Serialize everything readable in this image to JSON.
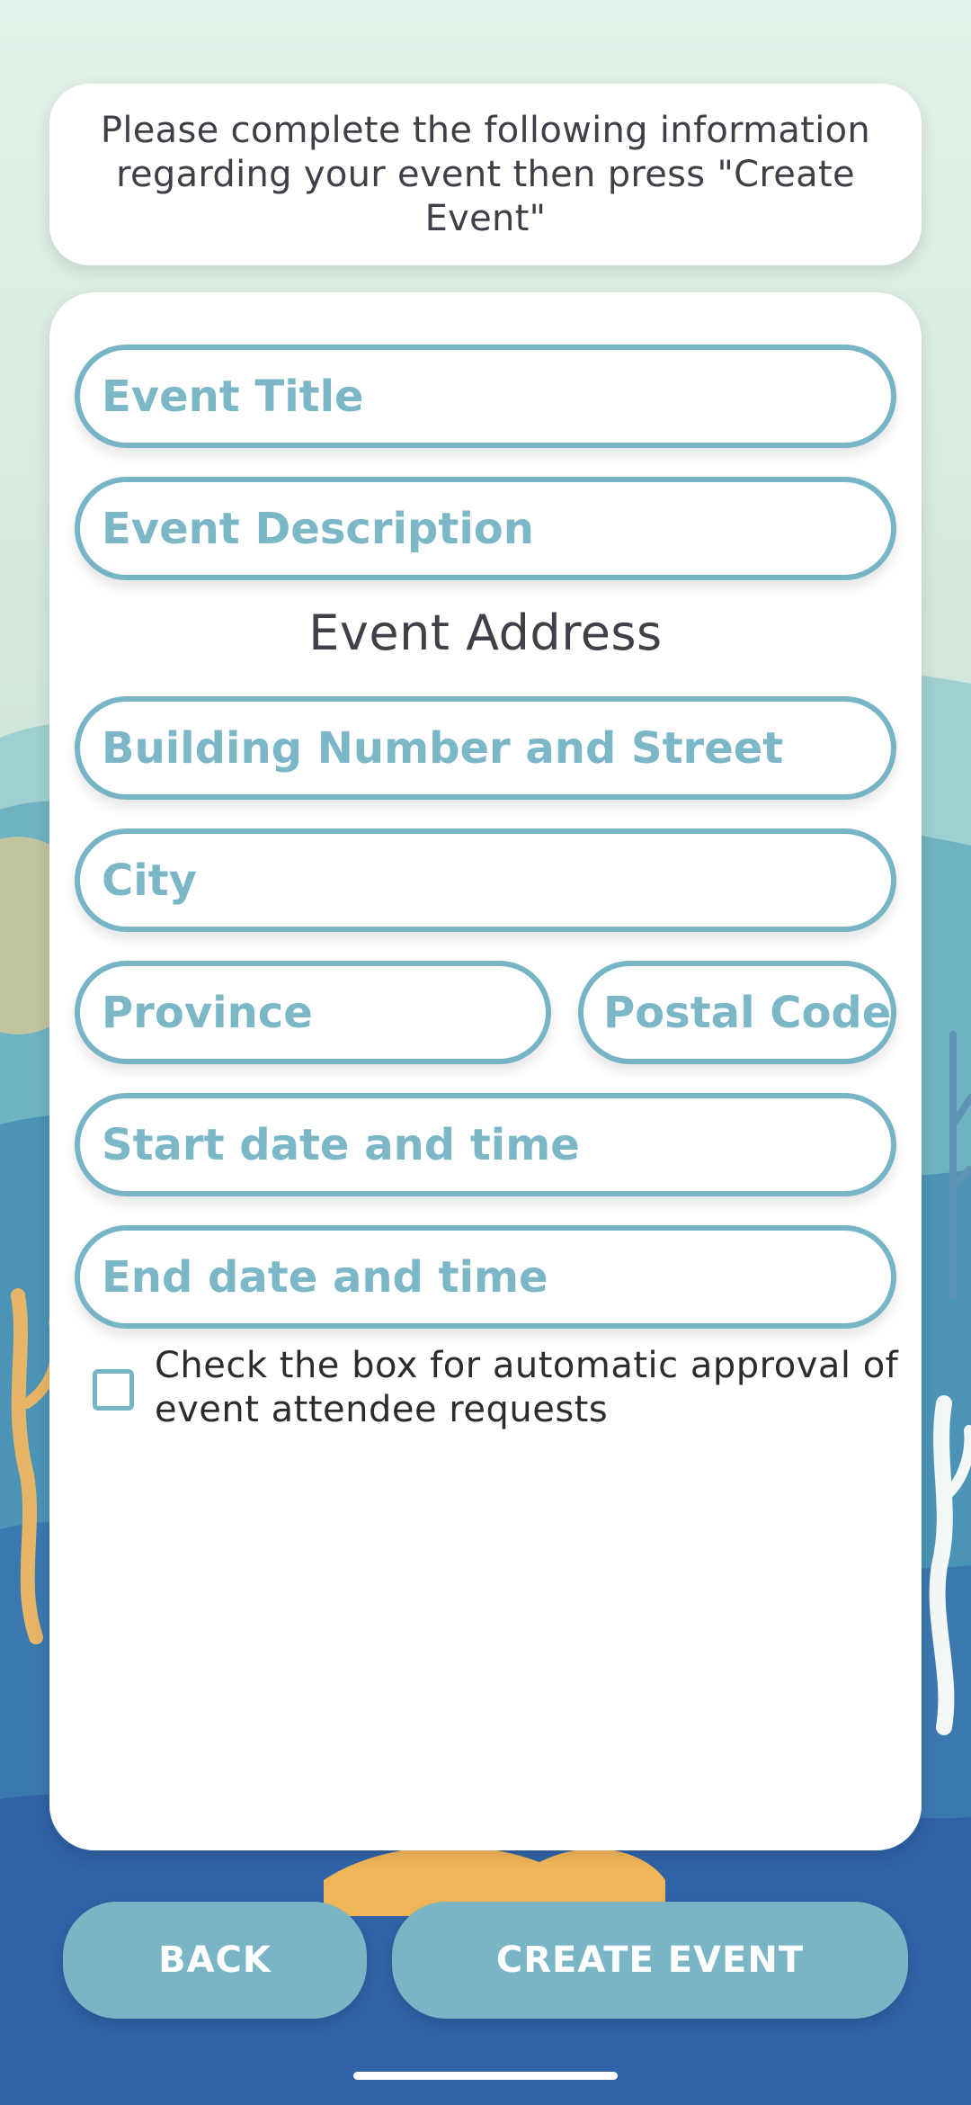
{
  "instructions": "Please complete the following information regarding your event then press \"Create Event\"",
  "form": {
    "event_title_placeholder": "Event Title",
    "event_description_placeholder": "Event Description",
    "address_heading": "Event Address",
    "street_placeholder": "Building Number and Street",
    "city_placeholder": "City",
    "province_placeholder": "Province",
    "postal_code_placeholder": "Postal Code",
    "start_placeholder": "Start date and time",
    "end_placeholder": "End date and time",
    "auto_approval_label": "Check the box for automatic approval of event attendee requests",
    "auto_approval_checked": false
  },
  "buttons": {
    "back_label": "BACK",
    "create_label": "CREATE EVENT"
  },
  "colors": {
    "accent": "#76b4c6",
    "button": "#7ab5c6",
    "heading_text": "#404049"
  }
}
